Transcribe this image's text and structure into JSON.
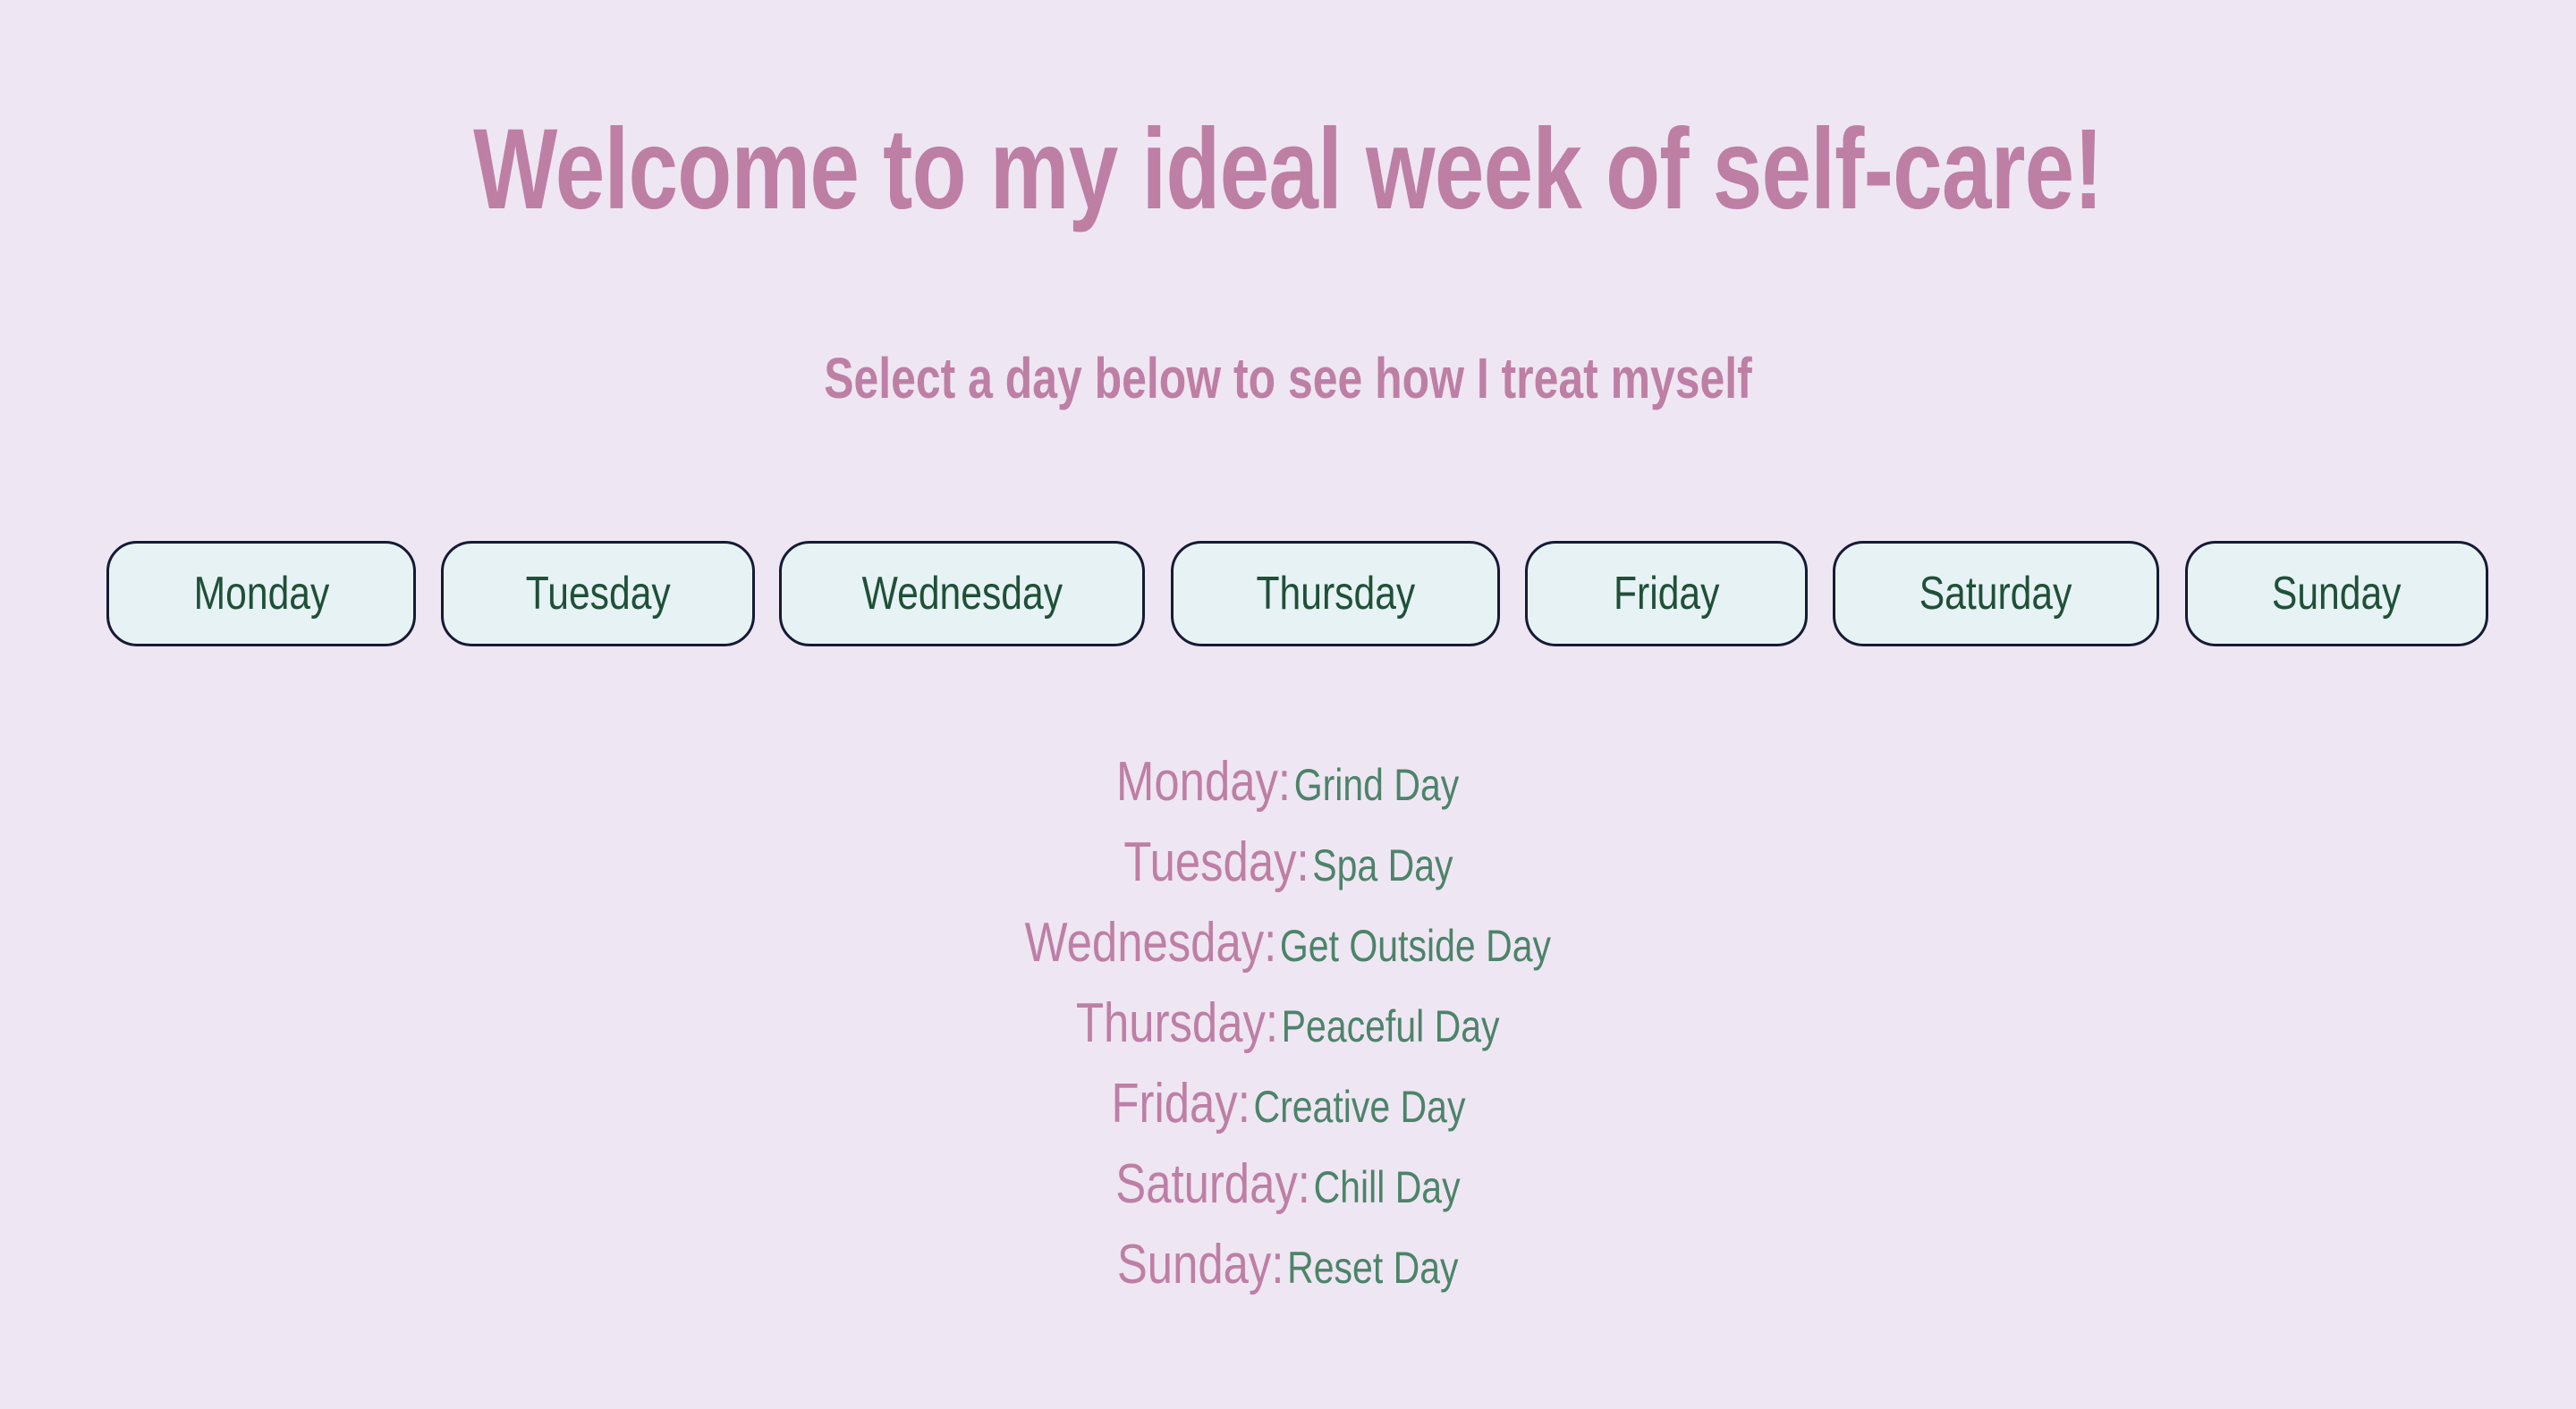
{
  "header": {
    "title": "Welcome to my ideal week of self-care!",
    "subtitle": "Select a day below to see how I treat myself"
  },
  "day_buttons": [
    {
      "label": "Monday"
    },
    {
      "label": "Tuesday"
    },
    {
      "label": "Wednesday"
    },
    {
      "label": "Thursday"
    },
    {
      "label": "Friday"
    },
    {
      "label": "Saturday"
    },
    {
      "label": "Sunday"
    }
  ],
  "schedule": [
    {
      "day": "Monday:",
      "theme": "Grind Day"
    },
    {
      "day": "Tuesday:",
      "theme": "Spa Day"
    },
    {
      "day": "Wednesday:",
      "theme": "Get Outside Day"
    },
    {
      "day": "Thursday:",
      "theme": "Peaceful Day"
    },
    {
      "day": "Friday:",
      "theme": "Creative Day"
    },
    {
      "day": "Saturday:",
      "theme": "Chill Day"
    },
    {
      "day": "Sunday:",
      "theme": "Reset Day"
    }
  ],
  "colors": {
    "background": "#efe6f3",
    "accent_pink": "#be7fa5",
    "button_bg": "#e7f2f4",
    "button_border": "#151b35",
    "button_text": "#1f5038",
    "description_green": "#4c8469"
  }
}
